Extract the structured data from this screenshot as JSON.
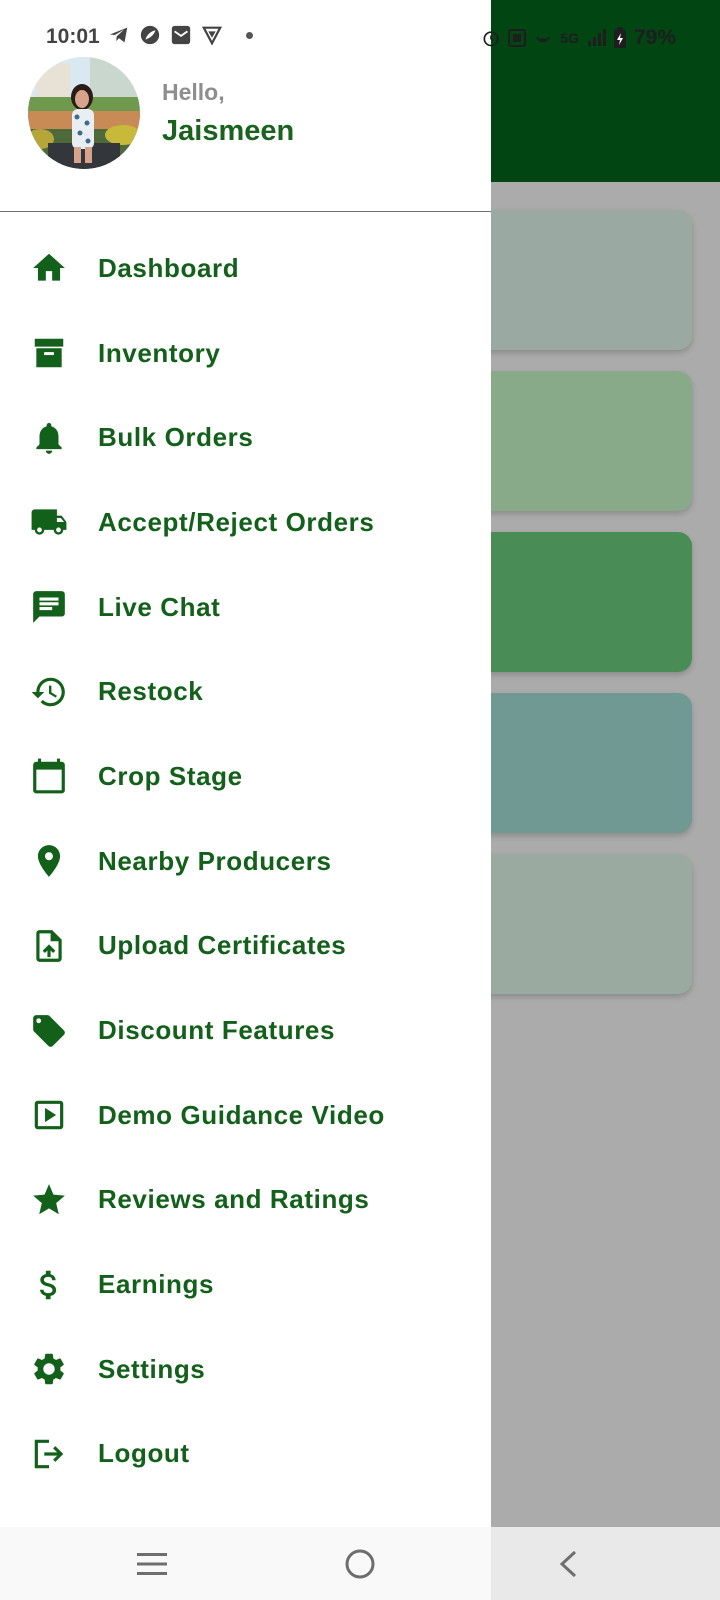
{
  "status_bar": {
    "time": "10:01",
    "left_icons": [
      "telegram-icon",
      "leaf-app-icon",
      "mail-icon",
      "vpn-shield-icon"
    ],
    "network_label": "5G",
    "battery": "79%"
  },
  "drawer": {
    "greeting": "Hello,",
    "user_name": "Jaismeen",
    "items": [
      {
        "label": "Dashboard",
        "icon": "home-icon"
      },
      {
        "label": "Inventory",
        "icon": "archive-box-icon"
      },
      {
        "label": "Bulk Orders",
        "icon": "bell-icon"
      },
      {
        "label": "Accept/Reject Orders",
        "icon": "truck-icon"
      },
      {
        "label": "Live Chat",
        "icon": "chat-icon"
      },
      {
        "label": "Restock",
        "icon": "history-icon"
      },
      {
        "label": "Crop Stage",
        "icon": "calendar-icon"
      },
      {
        "label": "Nearby Producers",
        "icon": "location-pin-icon"
      },
      {
        "label": "Upload Certificates",
        "icon": "file-upload-icon"
      },
      {
        "label": "Discount Features",
        "icon": "tag-icon"
      },
      {
        "label": "Demo Guidance Video",
        "icon": "play-video-icon"
      },
      {
        "label": "Reviews and Ratings",
        "icon": "star-icon"
      },
      {
        "label": "Earnings",
        "icon": "dollar-icon"
      },
      {
        "label": "Settings",
        "icon": "gear-icon"
      },
      {
        "label": "Logout",
        "icon": "logout-icon"
      }
    ]
  },
  "colors": {
    "brand_green": "#12601a",
    "header_green": "#004512",
    "greeting_gray": "#8e8e8e"
  },
  "nav_bar": {
    "buttons": [
      "recent-apps-icon",
      "home-circle-icon",
      "back-chevron-icon"
    ]
  }
}
